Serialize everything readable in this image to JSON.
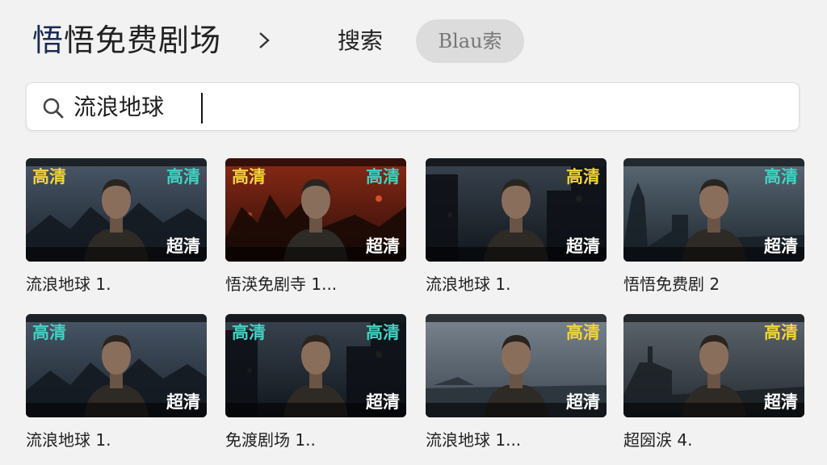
{
  "header": {
    "title_accent": "悟",
    "title_rest": "悟免费剧场",
    "search_label": "搜索",
    "pill_label": "Blau索"
  },
  "search": {
    "value": "流浪地球",
    "placeholder": ""
  },
  "colors": {
    "background": "#f2f2f2",
    "pill": "#dcdcdc",
    "badge_yellow": "#f2d43c",
    "badge_cyan": "#43d1c2",
    "badge_white": "#ffffff"
  },
  "cards": [
    {
      "title": "流浪地球 1.",
      "badge_left": "高清",
      "badge_left_color": "#f2d43c",
      "badge_right": "高清",
      "badge_right_color": "#43d1c2",
      "badge_corner": "超清",
      "scene": "storm"
    },
    {
      "title": "悟渶免剧寺 1...",
      "badge_left": "高清",
      "badge_left_color": "#f2d43c",
      "badge_right": "高清",
      "badge_right_color": "#43d1c2",
      "badge_corner": "超清",
      "scene": "fire"
    },
    {
      "title": "流浪地球 1.",
      "badge_left": "",
      "badge_left_color": "#f2d43c",
      "badge_right": "高清",
      "badge_right_color": "#f2d43c",
      "badge_corner": "超清",
      "scene": "street"
    },
    {
      "title": "悟悟免费剧 2",
      "badge_left": "",
      "badge_left_color": "#43d1c2",
      "badge_right": "高清",
      "badge_right_color": "#43d1c2",
      "badge_corner": "超清",
      "scene": "city"
    },
    {
      "title": "流浪地球 1.",
      "badge_left": "高清",
      "badge_left_color": "#43d1c2",
      "badge_right": "",
      "badge_right_color": "#43d1c2",
      "badge_corner": "超清",
      "scene": "storm"
    },
    {
      "title": "免渡剧场 1..",
      "badge_left": "高清",
      "badge_left_color": "#43d1c2",
      "badge_right": "高清",
      "badge_right_color": "#43d1c2",
      "badge_corner": "超清",
      "scene": "street"
    },
    {
      "title": "流浪地球 1...",
      "badge_left": "",
      "badge_left_color": "#f2d43c",
      "badge_right": "高清",
      "badge_right_color": "#f2d43c",
      "badge_corner": "超清",
      "scene": "harbor"
    },
    {
      "title": "超圀涙 4.",
      "badge_left": "",
      "badge_left_color": "#f2d43c",
      "badge_right": "高清",
      "badge_right_color": "#f2d43c",
      "badge_corner": "超清",
      "scene": "industrial"
    }
  ]
}
